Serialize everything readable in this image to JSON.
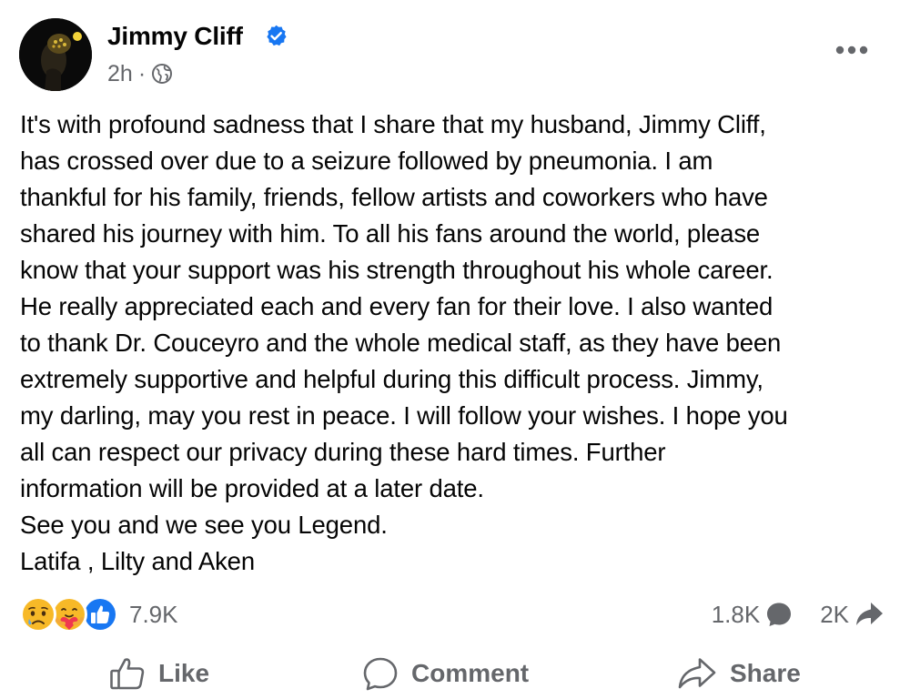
{
  "post": {
    "author": "Jimmy Cliff",
    "timestamp": "2h",
    "separator": "·",
    "audience_icon": "globe-icon",
    "verified_icon": "verified-badge-icon",
    "more_icon": "more-horizontal-icon",
    "body_lines": [
      "It's with profound sadness that I share that my husband, Jimmy Cliff,",
      "has crossed over due to a seizure followed by pneumonia. I am",
      "thankful for his family, friends, fellow artists and coworkers who have",
      "shared his journey with him. To all his fans around the world, please",
      "know that your support was his strength throughout his whole career.",
      "He really appreciated each and every fan for their love. I also wanted",
      "to thank Dr. Couceyro and the whole medical staff, as they have been",
      "extremely supportive and helpful during this difficult process. Jimmy,",
      "my darling, may you rest in peace. I will follow your wishes. I hope you",
      "all can respect our privacy during these hard times. Further",
      "information will be provided at a later date.",
      "See you and we see you Legend.",
      "Latifa , Lilty and Aken"
    ]
  },
  "reactions": {
    "icons": [
      "sad-reaction-icon",
      "care-reaction-icon",
      "like-reaction-icon"
    ],
    "count": "7.9K"
  },
  "engagement": {
    "comments_count": "1.8K",
    "comments_icon": "comment-bubble-icon",
    "shares_count": "2K",
    "shares_icon": "share-arrow-icon"
  },
  "actions": {
    "like_label": "Like",
    "comment_label": "Comment",
    "share_label": "Share"
  },
  "colors": {
    "text_primary": "#050505",
    "text_secondary": "#65676b",
    "verified_blue": "#1877f2",
    "like_blue": "#1877f2",
    "reaction_yellow": "#f7b928"
  }
}
